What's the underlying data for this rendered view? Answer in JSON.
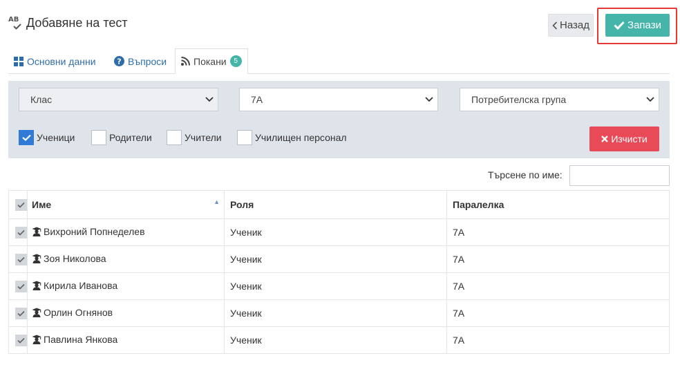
{
  "header": {
    "icon_text": "AB",
    "title": "Добавяне на тест"
  },
  "actions": {
    "back_label": "Назад",
    "save_label": "Запази"
  },
  "tabs": [
    {
      "label": "Основни данни",
      "icon": "grid-icon"
    },
    {
      "label": "Въпроси",
      "icon": "question-circle-icon"
    },
    {
      "label": "Покани",
      "icon": "rss-icon",
      "badge": "5"
    }
  ],
  "filters": {
    "select1": "Клас",
    "select2": "7А",
    "select3": "Потребителска група",
    "checkboxes": [
      {
        "label": "Ученици",
        "checked": true
      },
      {
        "label": "Родители",
        "checked": false
      },
      {
        "label": "Учители",
        "checked": false
      },
      {
        "label": "Училищен персонал",
        "checked": false
      }
    ],
    "clear_label": "Изчисти"
  },
  "search": {
    "label": "Търсене по име:",
    "value": ""
  },
  "table": {
    "columns": [
      "Име",
      "Роля",
      "Паралелка"
    ],
    "rows": [
      {
        "name": "Вихроний Попнеделев",
        "role": "Ученик",
        "class": "7А"
      },
      {
        "name": "Зоя Николова",
        "role": "Ученик",
        "class": "7А"
      },
      {
        "name": "Кирила Иванова",
        "role": "Ученик",
        "class": "7А"
      },
      {
        "name": "Орлин Огнянов",
        "role": "Ученик",
        "class": "7А"
      },
      {
        "name": "Павлина Янкова",
        "role": "Ученик",
        "class": "7А"
      }
    ]
  },
  "colors": {
    "accent": "#45b5aa",
    "danger": "#e84b57",
    "link": "#2f6da8",
    "checkbox": "#2f7bd5",
    "highlight": "#e53935"
  }
}
